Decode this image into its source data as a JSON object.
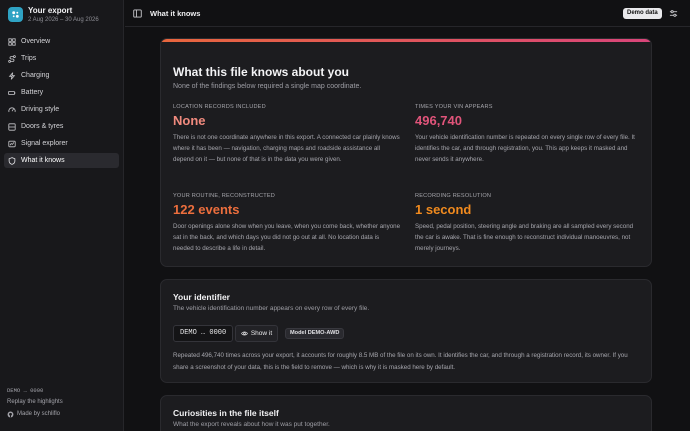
{
  "brand": {
    "title": "Your export",
    "date_range": "2 Aug 2026 – 30 Aug 2026"
  },
  "nav": [
    {
      "label": "Overview",
      "icon": "grid-icon"
    },
    {
      "label": "Trips",
      "icon": "route-icon"
    },
    {
      "label": "Charging",
      "icon": "bolt-icon"
    },
    {
      "label": "Battery",
      "icon": "battery-icon"
    },
    {
      "label": "Driving style",
      "icon": "gauge-icon"
    },
    {
      "label": "Doors & tyres",
      "icon": "door-icon"
    },
    {
      "label": "Signal explorer",
      "icon": "signal-icon"
    },
    {
      "label": "What it knows",
      "icon": "shield-icon",
      "active": true
    }
  ],
  "sidebar_footer": {
    "vin": "DEMO … 0000",
    "replay": "Replay the highlights",
    "made_by": "Made by schliflo"
  },
  "topbar": {
    "title": "What it knows",
    "badge": "Demo data"
  },
  "knows_card": {
    "title": "What this file knows about you",
    "subtitle": "None of the findings below required a single map coordinate.",
    "facts": [
      {
        "label": "LOCATION RECORDS INCLUDED",
        "value": "None",
        "color": "#f08a7e",
        "desc": "There is not one coordinate anywhere in this export. A connected car plainly knows where it has been — navigation, charging maps and roadside assistance all depend on it — but none of that is in the data you were given."
      },
      {
        "label": "TIMES YOUR VIN APPEARS",
        "value": "496,740",
        "color": "#e0547a",
        "desc": "Your vehicle identification number is repeated on every single row of every file. It identifies the car, and through registration, you. This app keeps it masked and never sends it anywhere."
      },
      {
        "label": "YOUR ROUTINE, RECONSTRUCTED",
        "value": "122 events",
        "color": "#ec6e3d",
        "desc": "Door openings alone show when you leave, when you come back, whether anyone sat in the back, and which days you did not go out at all. No location data is needed to describe a life in detail."
      },
      {
        "label": "RECORDING RESOLUTION",
        "value": "1 second",
        "color": "#f08a1e",
        "desc": "Speed, pedal position, steering angle and braking are all sampled every second the car is awake. That is fine enough to reconstruct individual manoeuvres, not merely journeys."
      }
    ]
  },
  "identifier_card": {
    "title": "Your identifier",
    "subtitle": "The vehicle identification number appears on every row of every file.",
    "vin": "DEMO … 0000",
    "show_label": "Show it",
    "model_badge": "Model DEMO-AWD",
    "body": "Repeated 496,740 times across your export, it accounts for roughly 8.5 MB of the file on its own. It identifies the car, and through a registration record, its owner. If you share a screenshot of your data, this is the field to remove — which is why it is masked here by default."
  },
  "curiosities_card": {
    "title": "Curiosities in the file itself",
    "subtitle": "What the export reveals about how it was put together."
  }
}
